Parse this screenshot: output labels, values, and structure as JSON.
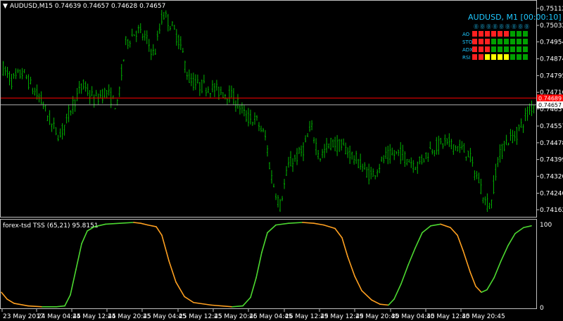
{
  "header": {
    "symbol_text": "AUDUSD,M15  0.74639 0.74657 0.74628 0.74657",
    "dropdown_glyph": "▼"
  },
  "prices": {
    "open": 0.74639,
    "high": 0.74657,
    "low": 0.74628,
    "close": 0.74657
  },
  "price_axis": {
    "labels": [
      "0.75112",
      "0.75032",
      "0.74954",
      "0.74874",
      "0.74795",
      "0.74716",
      "0.74637",
      "0.74557",
      "0.74478",
      "0.74399",
      "0.74320",
      "0.74240",
      "0.74162"
    ],
    "ylim": [
      0.74132,
      0.75145
    ],
    "red_line_value": "0.74689",
    "red_line_price": 0.74689,
    "current_value": "0.74657",
    "current_price": 0.74657
  },
  "time_axis": {
    "labels": [
      "23 May 2017",
      "24 May 04:45",
      "24 May 12:45",
      "24 May 20:45",
      "25 May 04:45",
      "25 May 12:45",
      "25 May 20:45",
      "26 May 04:45",
      "26 May 12:45",
      "29 May 12:45",
      "29 May 20:45",
      "30 May 04:45",
      "30 May 12:45",
      "30 May 20:45"
    ]
  },
  "indicator_window": {
    "title": "forex-tsd TSS (65,21) 95.8151",
    "scale_top": "100",
    "scale_bottom": "0"
  },
  "dashboard": {
    "title": "AUDUSD, M1 [00:00:10]",
    "timeframes": [
      "MN",
      "W1",
      "D1",
      "H4",
      "H1",
      "M30",
      "M15",
      "M5",
      "M1"
    ],
    "timeframe_glyphs": [
      "⓪",
      "⓪",
      "⓪",
      "⓪",
      "⓪",
      "⓪",
      "⓪",
      "⓪",
      "⓪"
    ],
    "rows": [
      {
        "label": "AO",
        "cells": [
          "red",
          "red",
          "red",
          "red",
          "red",
          "red",
          "green",
          "green",
          "green"
        ]
      },
      {
        "label": "STO",
        "cells": [
          "red",
          "red",
          "red",
          "green",
          "green",
          "green",
          "green",
          "green",
          "green"
        ]
      },
      {
        "label": "ADX",
        "cells": [
          "red",
          "red",
          "red",
          "green",
          "green",
          "green",
          "green",
          "green",
          "green"
        ]
      },
      {
        "label": "RSI",
        "cells": [
          "red",
          "red",
          "yellow",
          "yellow",
          "yellow",
          "yellow",
          "green",
          "green",
          "green"
        ]
      }
    ],
    "colors": {
      "red": "#ff2020",
      "green": "#00a000",
      "yellow": "#ffff00"
    }
  },
  "colors": {
    "background": "#000000",
    "candles": "#00b400",
    "red_line": "#ff0000",
    "current_line": "#b0b0b0",
    "tss_up": "#4cd830",
    "tss_down": "#ffa020",
    "axis": "#c0c0c0"
  },
  "chart_data": [
    {
      "type": "line",
      "title": "AUDUSD,M15",
      "note_series": "close price path",
      "x": [
        "23 May 2017",
        "24 May 04:45",
        "24 May 12:45",
        "24 May 20:45",
        "25 May 04:45",
        "25 May 12:45",
        "25 May 20:45",
        "26 May 04:45",
        "26 May 12:45",
        "29 May 12:45",
        "29 May 20:45",
        "30 May 04:45",
        "30 May 12:45",
        "30 May 20:45"
      ],
      "series": [
        {
          "values": [
            0.7483,
            0.7458,
            0.7467,
            0.7501,
            0.7505,
            0.7466,
            0.7458,
            0.7437,
            0.7446,
            0.7441,
            0.745,
            0.744,
            0.7442,
            0.7466
          ]
        }
      ],
      "ylim": [
        0.74132,
        0.75145
      ]
    },
    {
      "type": "line",
      "title": "forex-tsd TSS (65,21) 95.8151",
      "x": [
        "23 May 2017",
        "24 May 04:45",
        "24 May 12:45",
        "24 May 20:45",
        "25 May 04:45",
        "25 May 12:45",
        "25 May 20:45",
        "26 May 04:45",
        "26 May 12:45",
        "29 May 12:45",
        "29 May 20:45",
        "30 May 04:45",
        "30 May 12:45",
        "30 May 20:45"
      ],
      "series": [
        {
          "values": [
            18,
            0,
            1,
            90,
            100,
            97,
            40,
            3,
            1,
            92,
            100,
            93,
            42,
            1,
            3,
            62,
            98,
            82,
            20,
            17,
            55,
            96
          ]
        }
      ],
      "ylim": [
        0,
        100
      ]
    }
  ]
}
